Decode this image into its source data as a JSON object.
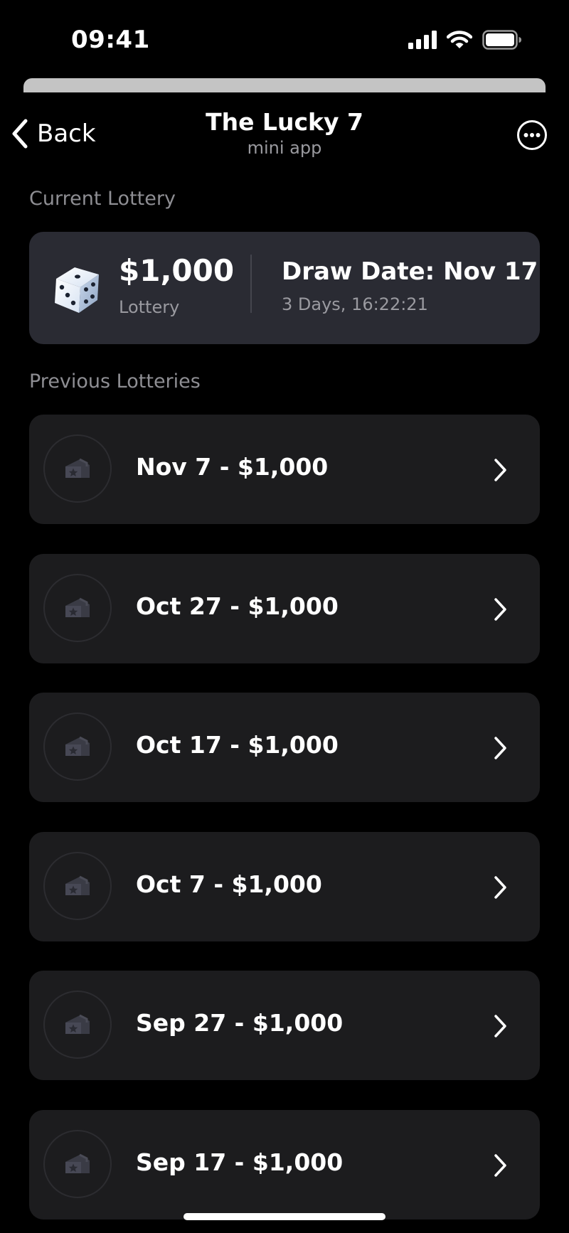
{
  "status": {
    "time": "09:41"
  },
  "nav": {
    "back_label": "Back",
    "title": "The Lucky 7",
    "subtitle": "mini app"
  },
  "current": {
    "section_label": "Current Lottery",
    "amount": "$1,000",
    "amount_caption": "Lottery",
    "draw_date": "Draw Date: Nov 17",
    "countdown": "3 Days, 16:22:21"
  },
  "previous": {
    "section_label": "Previous Lotteries",
    "items": [
      {
        "label": "Nov 7 - $1,000"
      },
      {
        "label": "Oct 27 - $1,000"
      },
      {
        "label": "Oct 17 - $1,000"
      },
      {
        "label": "Oct 7 - $1,000"
      },
      {
        "label": "Sep 27 - $1,000"
      },
      {
        "label": "Sep 17 - $1,000"
      }
    ]
  },
  "colors": {
    "background": "#000000",
    "card": "#1c1c1e",
    "current_card": "#2a2b33",
    "muted_text": "#8e8e93"
  }
}
